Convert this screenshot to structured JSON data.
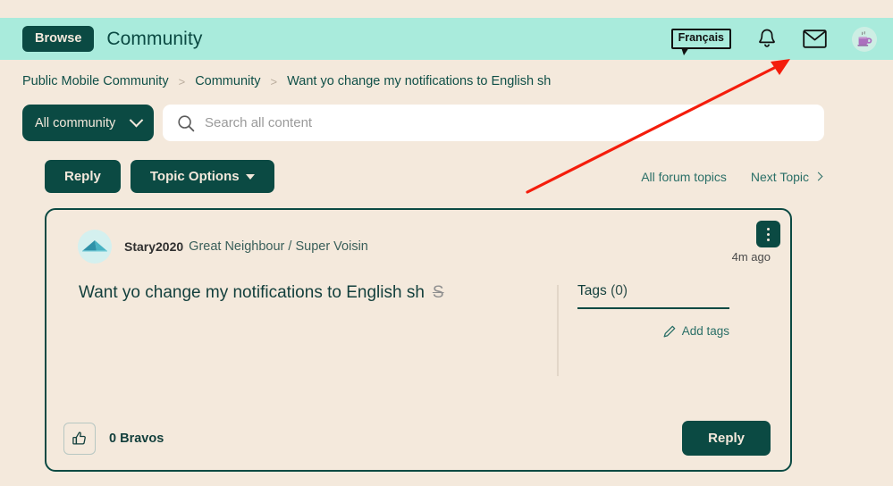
{
  "header": {
    "browse_label": "Browse",
    "title": "Community",
    "language_label": "Français",
    "icons": {
      "notifications": "bell-icon",
      "messages": "envelope-icon",
      "avatar": "coffee-mug-avatar-icon"
    }
  },
  "breadcrumb": {
    "items": [
      {
        "label": "Public Mobile Community"
      },
      {
        "label": "Community"
      },
      {
        "label": "Want yo change my notifications to English sh"
      }
    ],
    "separator": ">"
  },
  "search": {
    "scope_value": "All community",
    "placeholder": "Search all content",
    "value": ""
  },
  "actions": {
    "reply_label": "Reply",
    "topic_options_label": "Topic Options",
    "all_forum_topics_label": "All forum topics",
    "next_topic_label": "Next Topic"
  },
  "post": {
    "author_name": "Stary2020",
    "author_rank": "Great Neighbour / Super Voisin",
    "timestamp": "4m ago",
    "title": "Want yo change my notifications to English sh",
    "title_suffix": "S",
    "tags_label": "Tags",
    "tags_count": "(0)",
    "add_tags_label": "Add tags",
    "bravos_label": "0 Bravos",
    "reply_label": "Reply"
  },
  "colors": {
    "page_background": "#f4e9dc",
    "header_background": "#a9ebdc",
    "brand_dark": "#0b4a43",
    "link": "#2a6f67",
    "annotation_arrow": "#f41d0c"
  }
}
